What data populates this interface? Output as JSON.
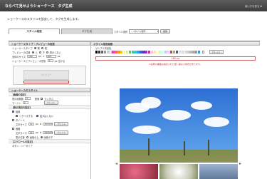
{
  "header": {
    "title": "ならべて見せようショーケース　タグ生成",
    "help": "使い方を見る ▼"
  },
  "intro": "ショーケースのスタイルを設定して、タグを生成します。",
  "tabs": [
    {
      "label": "スタイル設定"
    },
    {
      "label": "タグ生成"
    }
  ],
  "style_select": {
    "label": "スタイル選択",
    "value": "--スタイル選択--",
    "delete": "削除"
  },
  "left": {
    "sec1": "ショーケースタイプ・プレビューの指定",
    "type_label": "ショーケースタイプ",
    "type_opts": [
      "横",
      "縦"
    ],
    "preview_pos_label": "プレビューの位置",
    "preview_pos_opts": [
      "上",
      "下",
      "表示しない"
    ],
    "size_label": "全体のサイズ",
    "size_w": "180",
    "size_h": "400",
    "unit": "px",
    "gap_label": "ショーケースとプレビューの間を",
    "gap_val": "0",
    "gap_unit": "px 空ける",
    "preview_text": "プレビュー",
    "sec2": "ショーケースのスタイル",
    "sub1": "【画像の設定】",
    "count_label": "表示画像数",
    "count_val": "3",
    "arr_label": "配置",
    "arr_val": "ランダム",
    "margin_label": "マージン",
    "margin_val": "2",
    "color_btn": "パレット",
    "sub2": "【表示項目の設定】",
    "image_chk": "画像",
    "resize_chk": "リサイズする",
    "enlarge_chk": "拡大はしない",
    "title_chk": "タイトル",
    "font_label": "文字サイズ",
    "font_val": "12",
    "color_val": "555555",
    "price_chk": "価格",
    "font2_val": "12",
    "pos_label": "表示位置",
    "pos_opts": [
      "画像の上",
      "画像の下"
    ],
    "sub3": "【スクロールの設定】",
    "scroll_label": "ボタン・バータイプ"
  },
  "right": {
    "sec": "スタイル指定画面",
    "bg_label": "サンプル背景色",
    "palette_btn": "パレット",
    "ruler_text": "180 px",
    "note": "※実際の書面は指定された幅と異なる場合があります。"
  },
  "colors": {
    "accent": "#2b6cb0",
    "header": "#4a4a4a",
    "warn": "#cc3333"
  }
}
